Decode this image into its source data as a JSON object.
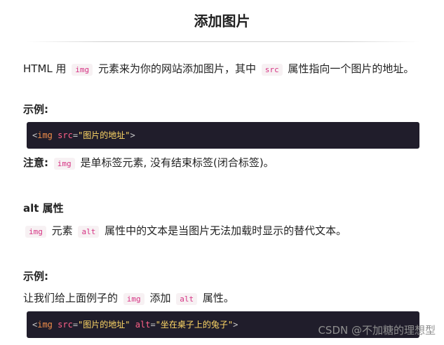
{
  "title": "添加图片",
  "intro": {
    "text1": "HTML 用",
    "code1": "img",
    "text2": "元素来为你的网站添加图片，其中",
    "code2": "src",
    "text3": "属性指向一个图片的地址。"
  },
  "example1": {
    "label": "示例:",
    "code": {
      "lt": "<",
      "tag": "img",
      "attr": "src",
      "eq": "=",
      "val": "\"图片的地址\"",
      "gt": ">"
    }
  },
  "note": {
    "label": "注意:",
    "code": "img",
    "text": "是单标签元素, 没有结束标签(闭合标签)。"
  },
  "alt_section": {
    "heading": "alt 属性",
    "code1": "img",
    "text1": "元素",
    "code2": "alt",
    "text2": "属性中的文本是当图片无法加载时显示的替代文本。"
  },
  "example2": {
    "label": "示例:",
    "text1": "让我们给上面例子的",
    "code1": "img",
    "text2": "添加",
    "code2": "alt",
    "text3": "属性。",
    "code": {
      "lt": "<",
      "tag": "img",
      "attr1": "src",
      "eq1": "=",
      "val1": "\"图片的地址\"",
      "attr2": "alt",
      "eq2": "=",
      "val2": "\"坐在桌子上的兔子\"",
      "gt": ">"
    }
  },
  "watermark": "CSDN @不加糖的理想型"
}
